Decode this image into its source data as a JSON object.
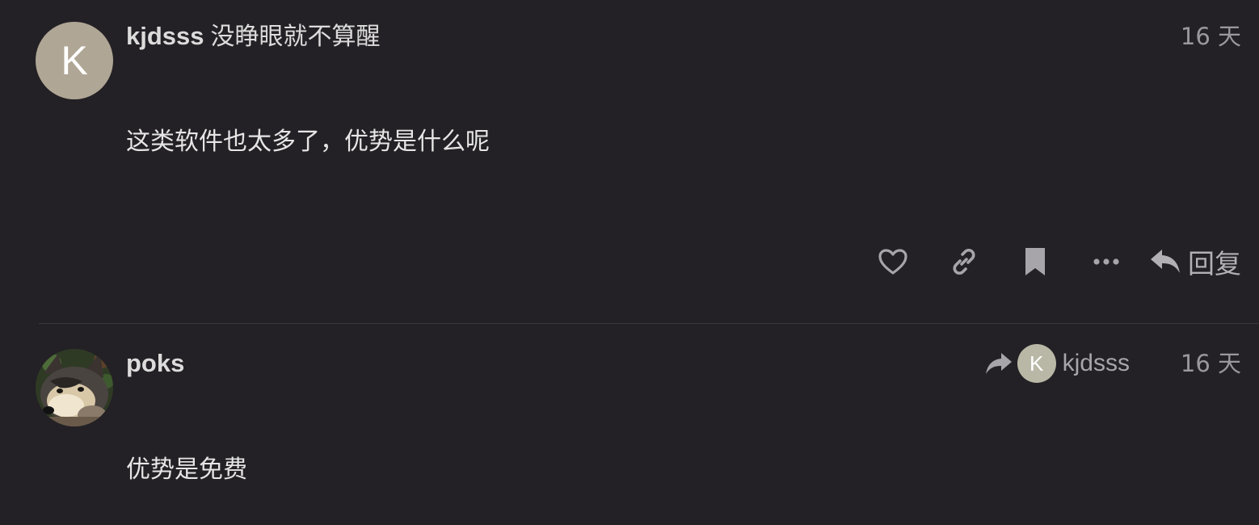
{
  "posts": [
    {
      "avatar_letter": "K",
      "avatar_color": "#b0a695",
      "username": "kjdsss",
      "full_name": "没睁眼就不算醒",
      "date": "16 天",
      "body": "这类软件也太多了，优势是什么呢",
      "actions": {
        "like_icon": "heart-icon",
        "link_icon": "link-icon",
        "bookmark_icon": "bookmark-icon",
        "more_icon": "ellipsis-icon",
        "reply_icon": "reply-arrow-icon",
        "reply_label": "回复"
      }
    },
    {
      "avatar_image": "husky-dog-photo",
      "username": "poks",
      "date": "16 天",
      "reply_to": {
        "icon": "reply-arrow-icon",
        "avatar_letter": "K",
        "avatar_color": "#b9b8a6",
        "username": "kjdsss"
      },
      "body": "优势是免费"
    }
  ],
  "colors": {
    "background": "#232125",
    "text": "#dcdcdc",
    "muted": "#9a989c",
    "divider": "#3a383c"
  }
}
